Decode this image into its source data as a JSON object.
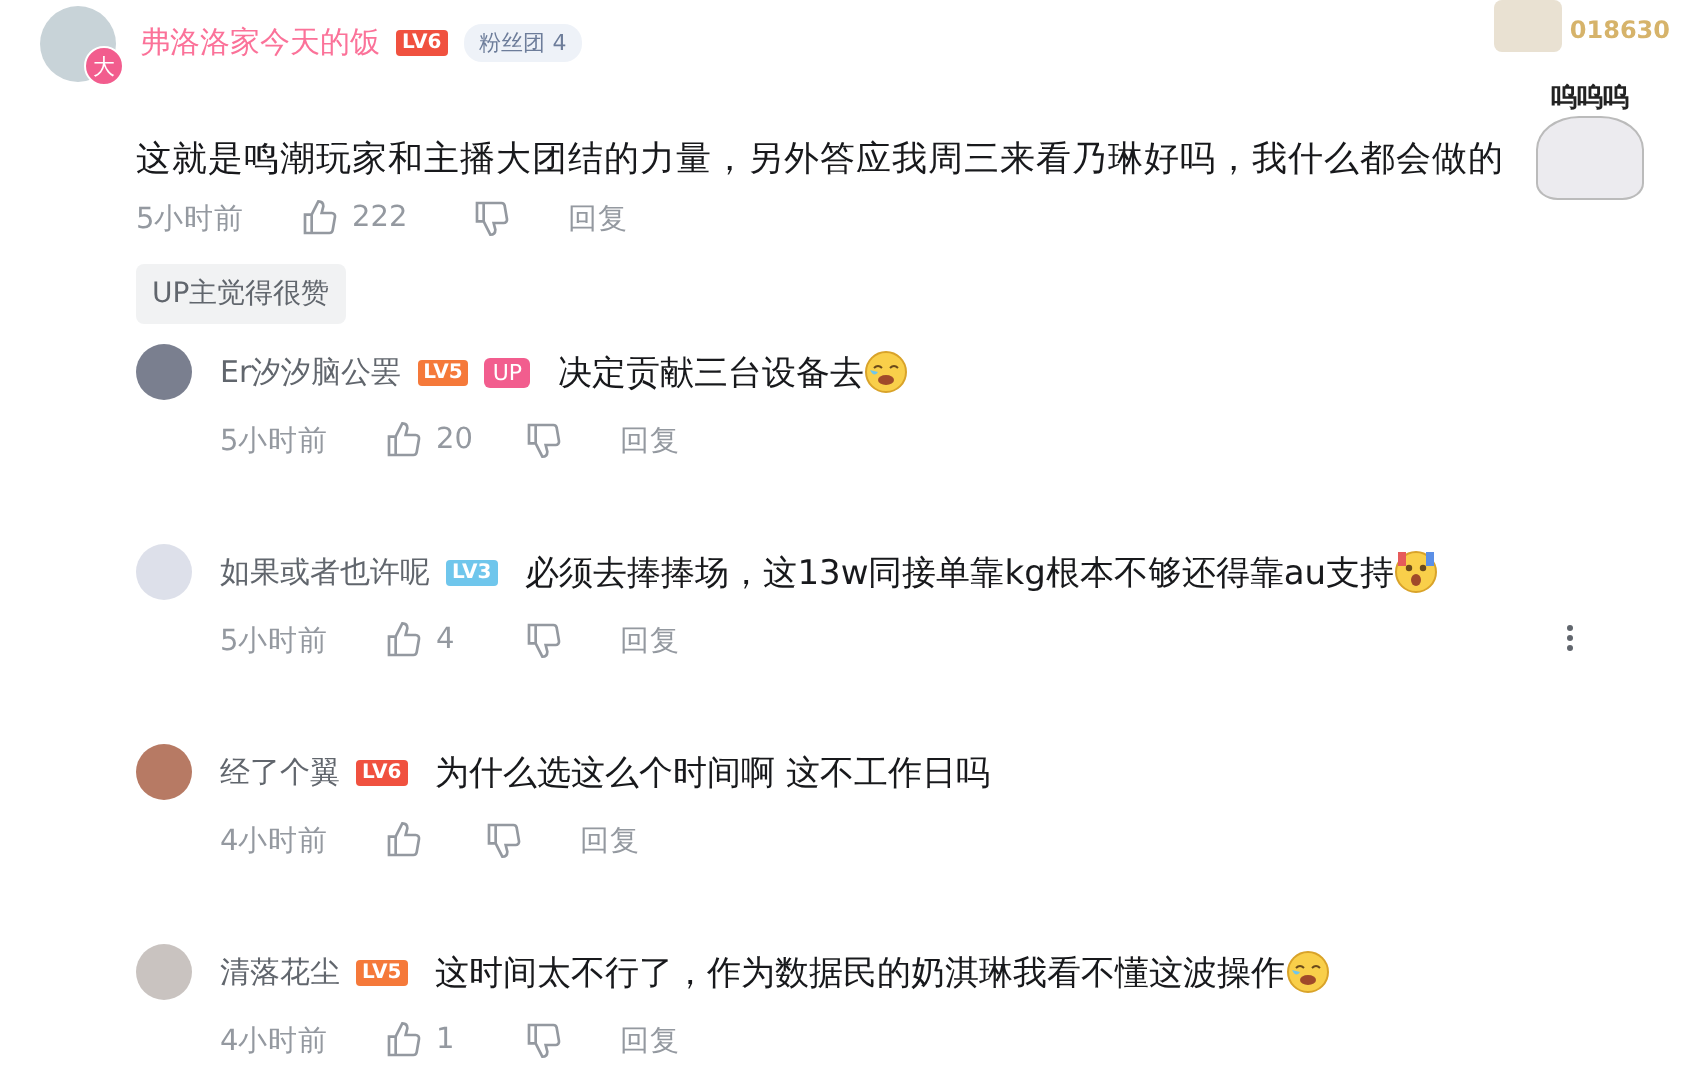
{
  "comment": {
    "user": "弗洛洛家今天的饭",
    "level": "LV6",
    "color": "#f0513f",
    "avatar_badge": "大",
    "fan_badge": {
      "label": "粉丝团",
      "count": "4"
    },
    "corner_badge": "018630",
    "sticker_caption": "呜呜呜",
    "text": "这就是鸣潮玩家和主播大团结的力量，另外答应我周三来看乃琳好吗，我什么都会做的",
    "time": "5小时前",
    "likes": "222",
    "reply": "回复",
    "up_liked": "UP主觉得很赞"
  },
  "replies": [
    {
      "user": "Er汐汐脑公罢",
      "level": "LV5",
      "color": "#f5793a",
      "is_up": true,
      "up_label": "UP",
      "text": "决定贡献三台设备去",
      "emoji": {
        "kind": "cry"
      },
      "time": "5小时前",
      "likes": "20",
      "reply": "回复",
      "more": false
    },
    {
      "user": "如果或者也许呢",
      "level": "LV3",
      "color": "#6fc6ec",
      "is_up": false,
      "text": "必须去捧捧场，这13w同接单靠kg根本不够还得靠au支持",
      "emoji": {
        "kind": "shock"
      },
      "time": "5小时前",
      "likes": "4",
      "reply": "回复",
      "more": true
    },
    {
      "user": "经了个翼",
      "level": "LV6",
      "color": "#f0513f",
      "is_up": false,
      "text": "为什么选这么个时间啊 这不工作日吗",
      "time": "4小时前",
      "reply": "回复",
      "more": false
    },
    {
      "user": "清落花尘",
      "level": "LV5",
      "color": "#f5793a",
      "is_up": false,
      "text": "这时间太不行了，作为数据民的奶淇琳我看不懂这波操作",
      "emoji": {
        "kind": "cry"
      },
      "time": "4小时前",
      "likes": "1",
      "reply": "回复",
      "more": false
    }
  ]
}
